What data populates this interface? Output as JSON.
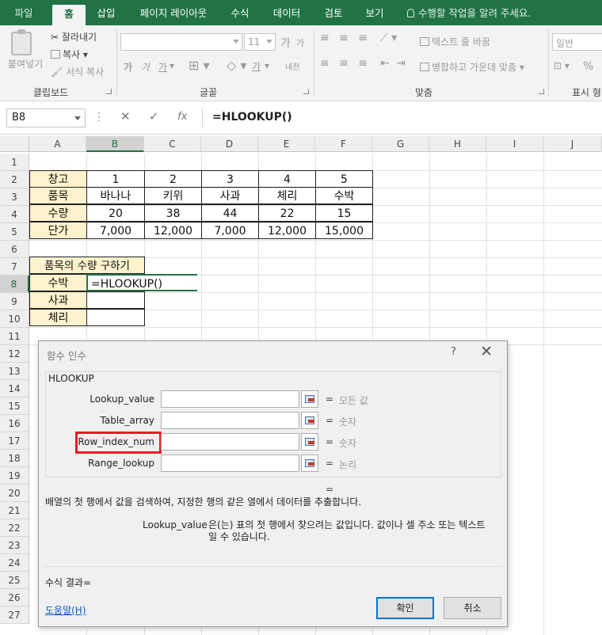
{
  "ribbon": {
    "tabs": [
      "파일",
      "홈",
      "삽입",
      "페이지 레이아웃",
      "수식",
      "데이터",
      "검토",
      "보기"
    ],
    "active_tab": "홈",
    "tell_me": "수행할 작업을 알려 주세요.",
    "clipboard": {
      "paste": "붙여넣기",
      "cut": "잘라내기",
      "copy": "복사",
      "format_painter": "서식 복사",
      "group": "클립보드"
    },
    "font": {
      "size": "11",
      "grow": "가",
      "shrink": "가",
      "bold": "가",
      "italic": "가",
      "underline": "가",
      "phonetic": "내천",
      "font_color": "가",
      "group": "글꼴"
    },
    "alignment": {
      "wrap_text": "텍스트 줄 바꿈",
      "merge_center": "병합하고 가운데 맞춤",
      "group": "맞춤"
    },
    "number": {
      "format": "일반",
      "percent": "%",
      "group": "표시 형"
    }
  },
  "formula_bar": {
    "name_box": "B8",
    "cancel": "✕",
    "enter": "✓",
    "fx": "fx",
    "formula": "=HLOOKUP()"
  },
  "grid": {
    "columns": [
      "A",
      "B",
      "C",
      "D",
      "E",
      "F",
      "G",
      "H",
      "I",
      "J"
    ],
    "rows": [
      "1",
      "2",
      "3",
      "4",
      "5",
      "6",
      "7",
      "8",
      "9",
      "10",
      "11",
      "12",
      "13",
      "14",
      "15",
      "16",
      "17",
      "18",
      "19",
      "20",
      "21",
      "22",
      "23",
      "24",
      "25",
      "26",
      "27"
    ],
    "table": {
      "row2": [
        "창고",
        "1",
        "2",
        "3",
        "4",
        "5"
      ],
      "row3": [
        "품목",
        "바나나",
        "키위",
        "사과",
        "체리",
        "수박"
      ],
      "row4": [
        "수량",
        "20",
        "38",
        "44",
        "22",
        "15"
      ],
      "row5": [
        "단가",
        "7,000",
        "12,000",
        "7,000",
        "12,000",
        "15,000"
      ]
    },
    "a7": "품목의 수량 구하기",
    "a8": "수박",
    "b8": "=HLOOKUP()",
    "a9": "사과",
    "a10": "체리"
  },
  "dialog": {
    "title": "함수 인수",
    "help": "?",
    "close": "✕",
    "function": "HLOOKUP",
    "args": [
      {
        "label": "Lookup_value",
        "value": "모든 값"
      },
      {
        "label": "Table_array",
        "value": "숫자"
      },
      {
        "label": "Row_index_num",
        "value": "숫자"
      },
      {
        "label": "Range_lookup",
        "value": "논리"
      }
    ],
    "eq": "=",
    "result_eq": "=",
    "description": "배열의 첫 행에서 값을 검색하여, 지정한 행의 같은 열에서 데이터를 추출합니다.",
    "arg_name": "Lookup_value",
    "arg_desc": "은(는) 표의 첫 행에서 찾으려는 값입니다. 값이나 셀 주소 또는 텍스트일 수 있습니다.",
    "formula_result": "수식 결과=",
    "help_link": "도움말(H)",
    "ok": "확인",
    "cancel": "취소"
  }
}
